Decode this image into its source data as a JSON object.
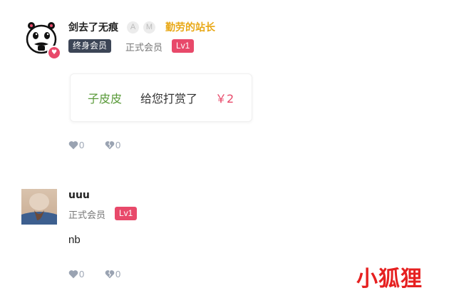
{
  "comments": [
    {
      "username": "剑去了无痕",
      "badges": [
        "A",
        "M"
      ],
      "title": "勤劳的站长",
      "membership_tag": "终身会员",
      "member_status": "正式会员",
      "level": "Lv1",
      "avatar_icon": "cartoon-face-icon",
      "reward": {
        "name": "子皮皮",
        "text": "给您打赏了",
        "amount": "￥2"
      },
      "likes": "0",
      "dislikes": "0"
    },
    {
      "username": "uuu",
      "member_status": "正式会员",
      "level": "Lv1",
      "avatar_icon": "photo-avatar",
      "body": "nb",
      "likes": "0",
      "dislikes": "0"
    }
  ],
  "watermark": "小狐狸",
  "colors": {
    "accent_pink": "#e8496a",
    "gold": "#e8a816",
    "reward_green": "#5a9a3a",
    "tag_dark": "#3c4556",
    "watermark_red": "#e62020"
  }
}
